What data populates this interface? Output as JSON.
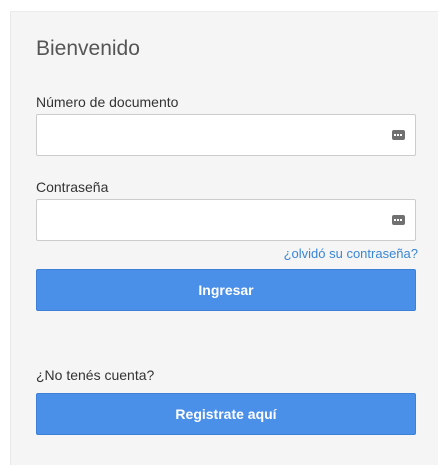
{
  "form": {
    "title": "Bienvenido",
    "document_label": "Número de documento",
    "document_value": "",
    "password_label": "Contraseña",
    "password_value": "",
    "forgot_link": "¿olvidó su contraseña?",
    "login_button": "Ingresar",
    "no_account_text": "¿No tenés cuenta?",
    "register_button": "Registrate aquí"
  },
  "colors": {
    "primary_button": "#4a8fe8",
    "link": "#3a86d4",
    "panel_background": "#f5f5f5"
  },
  "icons": {
    "document_field_icon": "password-key-icon",
    "password_field_icon": "password-key-icon"
  }
}
